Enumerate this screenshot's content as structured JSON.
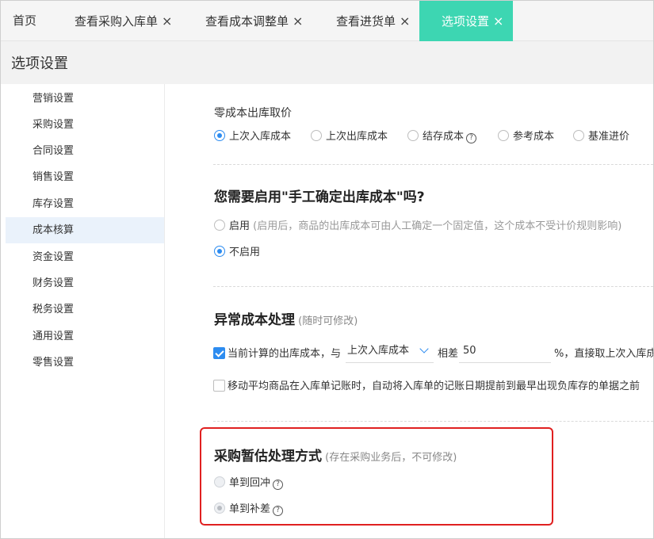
{
  "tabs": [
    {
      "label": "首页",
      "closable": false,
      "active": false
    },
    {
      "label": "查看采购入库单",
      "closable": true,
      "active": false
    },
    {
      "label": "查看成本调整单",
      "closable": true,
      "active": false
    },
    {
      "label": "查看进货单",
      "closable": true,
      "active": false
    },
    {
      "label": "选项设置",
      "closable": true,
      "active": true
    }
  ],
  "close_glyph": "×",
  "page_title": "选项设置",
  "sidebar": {
    "items": [
      {
        "label": "营销设置",
        "active": false
      },
      {
        "label": "采购设置",
        "active": false
      },
      {
        "label": "合同设置",
        "active": false
      },
      {
        "label": "销售设置",
        "active": false
      },
      {
        "label": "库存设置",
        "active": false
      },
      {
        "label": "成本核算",
        "active": true
      },
      {
        "label": "资金设置",
        "active": false
      },
      {
        "label": "财务设置",
        "active": false
      },
      {
        "label": "税务设置",
        "active": false
      },
      {
        "label": "通用设置",
        "active": false
      },
      {
        "label": "零售设置",
        "active": false
      }
    ]
  },
  "zero_cost": {
    "title": "零成本出库取价",
    "options": [
      {
        "label": "上次入库成本",
        "checked": true,
        "help": false
      },
      {
        "label": "上次出库成本",
        "checked": false,
        "help": false
      },
      {
        "label": "结存成本",
        "checked": false,
        "help": true
      },
      {
        "label": "参考成本",
        "checked": false,
        "help": false
      },
      {
        "label": "基准进价",
        "checked": false,
        "help": false
      }
    ]
  },
  "manual_cost": {
    "title": "您需要启用\"手工确定出库成本\"吗?",
    "enable_label": "启用",
    "enable_hint": "(启用后，商品的出库成本可由人工确定一个固定值，这个成本不受计价规则影响)",
    "disable_label": "不启用",
    "selected": "disable"
  },
  "abnormal_cost": {
    "title": "异常成本处理",
    "hint": "(随时可修改)",
    "row1_prefix": "当前计算的出库成本，与",
    "row1_select": "上次入库成本",
    "row1_mid": "相差",
    "row1_value": "50",
    "row1_suffix": "%，直接取上次入库成",
    "row1_checked": true,
    "row2_label": "移动平均商品在入库单记账时，自动将入库单的记账日期提前到最早出现负库存的单据之前",
    "row2_checked": false
  },
  "provisional": {
    "title": "采购暂估处理方式",
    "hint": "(存在采购业务后，不可修改)",
    "options": [
      {
        "label": "单到回冲",
        "checked": false
      },
      {
        "label": "单到补差",
        "checked": true
      }
    ]
  },
  "icons": {
    "help": "?"
  },
  "colors": {
    "active_tab": "#3dd6b2",
    "primary": "#2d8cf0",
    "highlight_border": "#e02020",
    "sidebar_active_bg": "#eaf2fb"
  }
}
